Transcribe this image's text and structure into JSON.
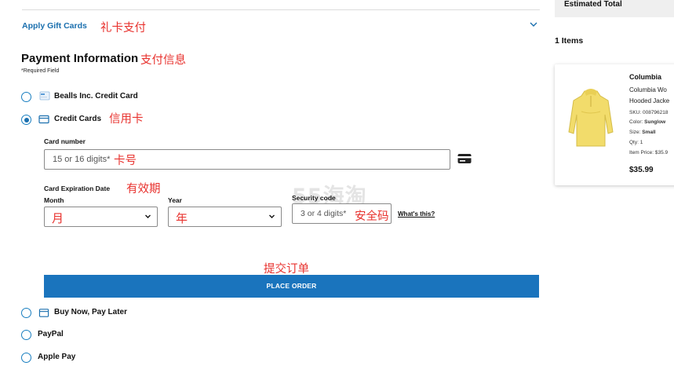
{
  "checkout": {
    "gift_cards_label": "Apply Gift Cards",
    "gift_cards_note": "礼卡支付",
    "payment_title": "Payment Information",
    "payment_note": "支付信息",
    "required_text": "*Required Field",
    "options": {
      "bealls": "Bealls Inc. Credit Card",
      "credit": "Credit Cards",
      "credit_note": "信用卡",
      "bnpl": "Buy Now, Pay Later",
      "paypal": "PayPal",
      "applepay": "Apple Pay"
    },
    "selected_option": "credit",
    "card_number": {
      "label": "Card number",
      "placeholder": "15 or 16 digits*",
      "note": "卡号"
    },
    "expiration": {
      "label": "Card Expiration Date",
      "note": "有效期",
      "month_label": "Month",
      "month_value": "月",
      "year_label": "Year",
      "year_value": "年"
    },
    "security": {
      "label": "Security code",
      "placeholder": "3 or 4 digits*",
      "note": "安全码",
      "help_link": "What's this?"
    },
    "watermark": "55海淘",
    "submit_note": "提交订单",
    "place_order": "PLACE ORDER"
  },
  "summary": {
    "estimated_total_label": "Estimated Total",
    "items_count": "1 Items",
    "product": {
      "brand": "Columbia",
      "name_line1": "Columbia Wo",
      "name_line2": "Hooded Jacke",
      "sku": "SKU: 008796218",
      "color_label": "Color:",
      "color_value": "Sunglow",
      "size_label": "Size:",
      "size_value": "Small",
      "qty": "Qty: 1",
      "item_price": "Item Price: $35.9",
      "price": "$35.99"
    }
  },
  "colors": {
    "accent": "#1a74bd",
    "link": "#1a6fae",
    "annotation": "#e8322e",
    "jacket": "#f2dc6b"
  },
  "icons": [
    "chevron-down-icon",
    "bealls-card-icon",
    "credit-card-icon",
    "card-type-icon",
    "wallet-icon"
  ]
}
